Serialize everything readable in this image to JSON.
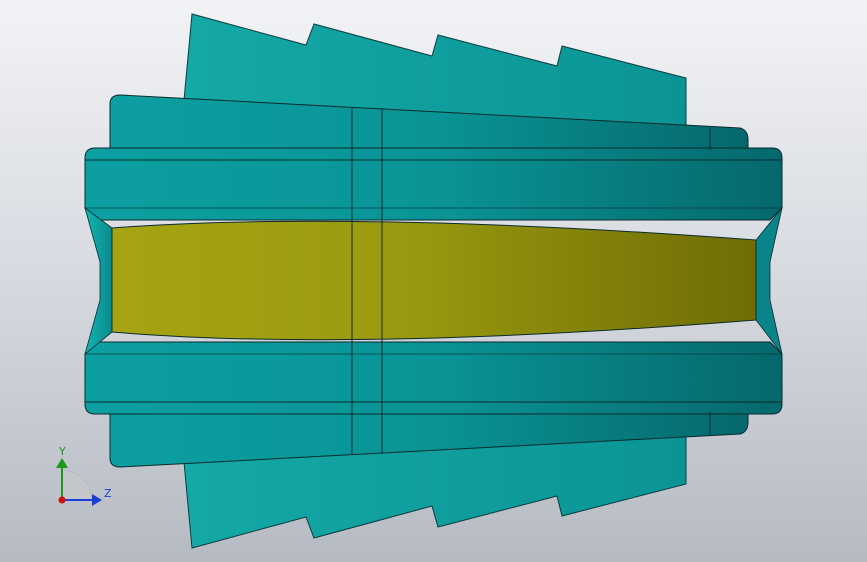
{
  "viewport": {
    "background_top": "#f2f3f6",
    "background_bottom": "#b6bac2"
  },
  "model": {
    "description_icon": "3d-part-icon",
    "body_color": "#0a9a9c",
    "body_dark": "#06787c",
    "fin_color": "#11a3a3",
    "insert_color": "#a6a515",
    "insert_dark": "#7a7a0a",
    "edge_color": "#0b2b2c"
  },
  "triad": {
    "y_label": "Y",
    "z_label": "Z",
    "y_color": "#1a9a1a",
    "z_color": "#1a3fd6",
    "x_color": "#d01010"
  }
}
